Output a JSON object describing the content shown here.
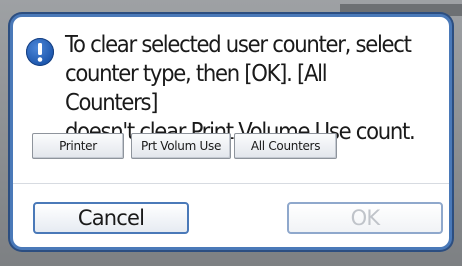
{
  "dialog": {
    "message_lines": [
      "To clear selected user counter, select",
      "counter type, then [OK]. [All Counters]",
      "doesn't clear Print Volume Use count."
    ],
    "counter_types": [
      {
        "label": "Printer"
      },
      {
        "label": "Prt Volum Use"
      },
      {
        "label": "All Counters"
      }
    ],
    "cancel_label": "Cancel",
    "ok_label": "OK",
    "ok_enabled": false
  },
  "colors": {
    "frame_border": "#4a79b8",
    "info_icon": "#1d57ad",
    "disabled_text": "#c0c4ca"
  },
  "icons": {
    "info": "info-icon"
  }
}
